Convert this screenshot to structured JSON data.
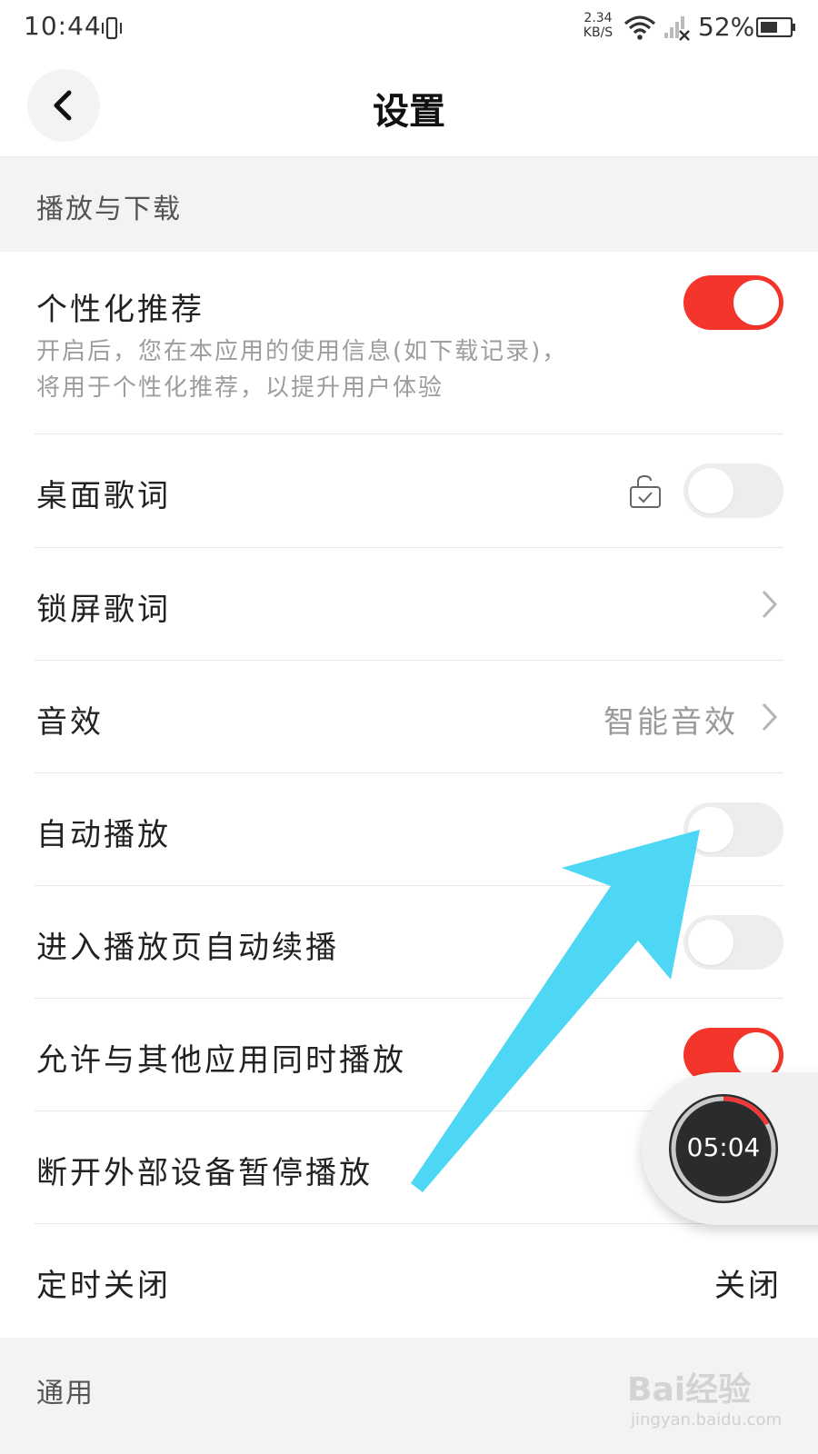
{
  "status_bar": {
    "time": "10:44",
    "net_speed_value": "2.34",
    "net_speed_unit": "KB/S",
    "battery": "52%",
    "icons": [
      "vibrate-icon",
      "wifi-icon",
      "signal-icon",
      "battery-icon"
    ]
  },
  "header": {
    "title": "设置",
    "back_icon": "chevron-left-icon"
  },
  "sections": {
    "playback": "播放与下载",
    "general": "通用"
  },
  "settings": {
    "personalized": {
      "label": "个性化推荐",
      "desc_line1": "开启后，您在本应用的使用信息(如下载记录)，",
      "desc_line2": "将用于个性化推荐，以提升用户体验",
      "enabled": true
    },
    "desktop_lyrics": {
      "label": "桌面歌词",
      "enabled": false,
      "icon": "lock-icon"
    },
    "lockscreen_lyrics": {
      "label": "锁屏歌词"
    },
    "sound_effect": {
      "label": "音效",
      "value": "智能音效"
    },
    "autoplay": {
      "label": "自动播放",
      "enabled": false
    },
    "continue_playback": {
      "label": "进入播放页自动续播",
      "enabled": false
    },
    "mix_playback": {
      "label": "允许与其他应用同时播放",
      "enabled": true
    },
    "pause_on_disconnect": {
      "label": "断开外部设备暂停播放"
    },
    "sleep_timer": {
      "label": "定时关闭",
      "value": "关闭"
    }
  },
  "floating_timer": {
    "time": "05:04"
  },
  "watermark": {
    "text": "Bai经验",
    "url": "jingyan.baidu.com"
  },
  "colors": {
    "toggle_on": "#f3352b",
    "arrow": "#4cd3f2",
    "section_bg": "#f3f3f4"
  }
}
